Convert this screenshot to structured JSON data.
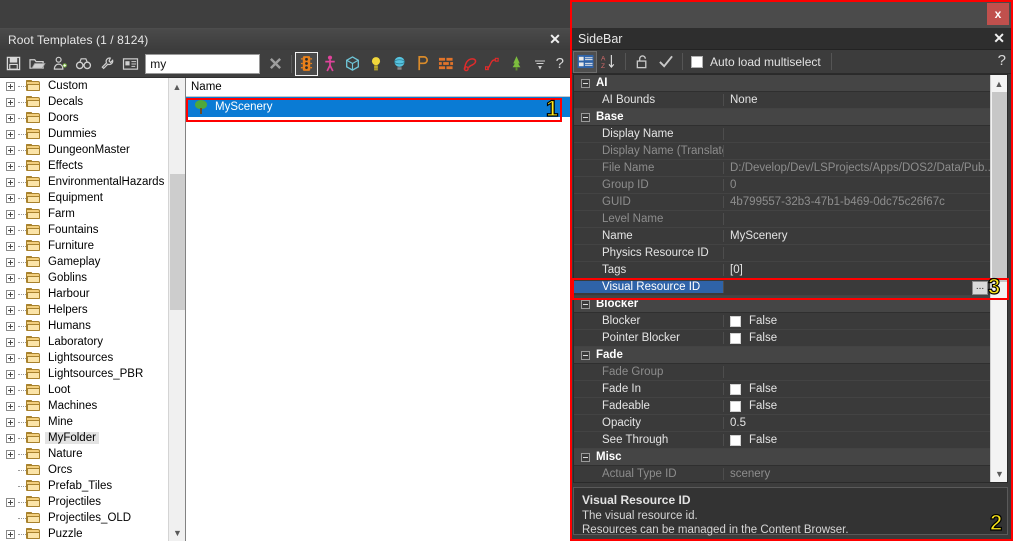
{
  "left_window": {
    "title": "Root Templates (1 / 8124)",
    "close_label": "✕",
    "toolbar": {
      "icons": [
        "save-icon",
        "open-folder-icon",
        "add-person-icon",
        "binoculars-icon",
        "wrench-icon",
        "properties-icon"
      ],
      "clear_label": "✖",
      "filter_icons": [
        "traffic-light-icon",
        "character-icon",
        "box-icon",
        "light-bulb-icon",
        "sphere-icon",
        "prefab-icon",
        "wall-icon",
        "decal-icon",
        "spline-icon",
        "terrain-icon"
      ],
      "dropdown_label": "▾",
      "help_label": "?"
    },
    "search": {
      "value": "my",
      "placeholder": ""
    },
    "tree": [
      {
        "label": "Custom",
        "expandable": true,
        "selected": false
      },
      {
        "label": "Decals",
        "expandable": true,
        "selected": false
      },
      {
        "label": "Doors",
        "expandable": true,
        "selected": false
      },
      {
        "label": "Dummies",
        "expandable": true,
        "selected": false
      },
      {
        "label": "DungeonMaster",
        "expandable": true,
        "selected": false
      },
      {
        "label": "Effects",
        "expandable": true,
        "selected": false
      },
      {
        "label": "EnvironmentalHazards",
        "expandable": true,
        "selected": false
      },
      {
        "label": "Equipment",
        "expandable": true,
        "selected": false
      },
      {
        "label": "Farm",
        "expandable": true,
        "selected": false
      },
      {
        "label": "Fountains",
        "expandable": true,
        "selected": false
      },
      {
        "label": "Furniture",
        "expandable": true,
        "selected": false
      },
      {
        "label": "Gameplay",
        "expandable": true,
        "selected": false
      },
      {
        "label": "Goblins",
        "expandable": true,
        "selected": false
      },
      {
        "label": "Harbour",
        "expandable": true,
        "selected": false
      },
      {
        "label": "Helpers",
        "expandable": true,
        "selected": false
      },
      {
        "label": "Humans",
        "expandable": true,
        "selected": false
      },
      {
        "label": "Laboratory",
        "expandable": true,
        "selected": false
      },
      {
        "label": "Lightsources",
        "expandable": true,
        "selected": false
      },
      {
        "label": "Lightsources_PBR",
        "expandable": true,
        "selected": false
      },
      {
        "label": "Loot",
        "expandable": true,
        "selected": false
      },
      {
        "label": "Machines",
        "expandable": true,
        "selected": false
      },
      {
        "label": "Mine",
        "expandable": true,
        "selected": false
      },
      {
        "label": "MyFolder",
        "expandable": true,
        "selected": true
      },
      {
        "label": "Nature",
        "expandable": true,
        "selected": false
      },
      {
        "label": "Orcs",
        "expandable": false,
        "selected": false
      },
      {
        "label": "Prefab_Tiles",
        "expandable": false,
        "selected": false
      },
      {
        "label": "Projectiles",
        "expandable": true,
        "selected": false
      },
      {
        "label": "Projectiles_OLD",
        "expandable": false,
        "selected": false
      },
      {
        "label": "Puzzle",
        "expandable": true,
        "selected": false
      }
    ],
    "list": {
      "header": "Name",
      "rows": [
        {
          "label": "MyScenery",
          "icon": "tree-icon",
          "selected": true
        }
      ]
    }
  },
  "right_window": {
    "close_badge": "x",
    "title": "SideBar",
    "close_label": "✕",
    "toolbar": {
      "categorized_label": "categorized-view-icon",
      "sort_label": "alpha-sort-icon",
      "lock_label": "unlock-icon",
      "apply_label": "checkmark-icon",
      "checkbox_label": "Auto load multiselect",
      "checkbox_checked": false,
      "help_label": "?"
    },
    "properties": [
      {
        "type": "group",
        "name": "AI"
      },
      {
        "type": "row",
        "name": "AI Bounds",
        "value": "None",
        "dim": false,
        "control": "text"
      },
      {
        "type": "group",
        "name": "Base"
      },
      {
        "type": "row",
        "name": "Display Name",
        "value": "",
        "dim": false,
        "control": "text"
      },
      {
        "type": "row",
        "name": "Display Name (Translated)",
        "value": "",
        "dim": true,
        "control": "text"
      },
      {
        "type": "row",
        "name": "File Name",
        "value": "D:/Develop/Dev/LSProjects/Apps/DOS2/Data/Pub...",
        "dim": true,
        "control": "text"
      },
      {
        "type": "row",
        "name": "Group ID",
        "value": "0",
        "dim": true,
        "control": "text"
      },
      {
        "type": "row",
        "name": "GUID",
        "value": "4b799557-32b3-47b1-b469-0dc75c26f67c",
        "dim": true,
        "control": "text"
      },
      {
        "type": "row",
        "name": "Level Name",
        "value": "",
        "dim": true,
        "control": "text"
      },
      {
        "type": "row",
        "name": "Name",
        "value": "MyScenery",
        "dim": false,
        "control": "text"
      },
      {
        "type": "row",
        "name": "Physics Resource ID",
        "value": "",
        "dim": false,
        "control": "text"
      },
      {
        "type": "row",
        "name": "Tags",
        "value": "[0]",
        "dim": false,
        "control": "text"
      },
      {
        "type": "row",
        "name": "Visual Resource ID",
        "value": "",
        "dim": false,
        "control": "ellipsis",
        "selected": true,
        "ellipsis_label": "..."
      },
      {
        "type": "group",
        "name": "Blocker"
      },
      {
        "type": "row",
        "name": "Blocker",
        "value": "False",
        "dim": false,
        "control": "checkbox"
      },
      {
        "type": "row",
        "name": "Pointer Blocker",
        "value": "False",
        "dim": false,
        "control": "checkbox"
      },
      {
        "type": "group",
        "name": "Fade"
      },
      {
        "type": "row",
        "name": "Fade Group",
        "value": "",
        "dim": true,
        "control": "text"
      },
      {
        "type": "row",
        "name": "Fade In",
        "value": "False",
        "dim": false,
        "control": "checkbox"
      },
      {
        "type": "row",
        "name": "Fadeable",
        "value": "False",
        "dim": false,
        "control": "checkbox"
      },
      {
        "type": "row",
        "name": "Opacity",
        "value": "0.5",
        "dim": false,
        "control": "text"
      },
      {
        "type": "row",
        "name": "See Through",
        "value": "False",
        "dim": false,
        "control": "checkbox"
      },
      {
        "type": "group",
        "name": "Misc"
      },
      {
        "type": "row",
        "name": "Actual Type ID",
        "value": "scenery",
        "dim": true,
        "control": "text"
      }
    ],
    "description": {
      "title": "Visual Resource ID",
      "line1": "The visual resource id.",
      "line2": "Resources can be managed in the Content Browser."
    }
  },
  "annotations": [
    {
      "number": "1"
    },
    {
      "number": "2"
    },
    {
      "number": "3"
    }
  ],
  "colors": {
    "selection_blue": "#0a7bd4",
    "prop_selection": "#2f63a8",
    "annotation_red": "#ff0000",
    "annotation_yellow": "#ffe919",
    "close_red": "#c0504d"
  }
}
